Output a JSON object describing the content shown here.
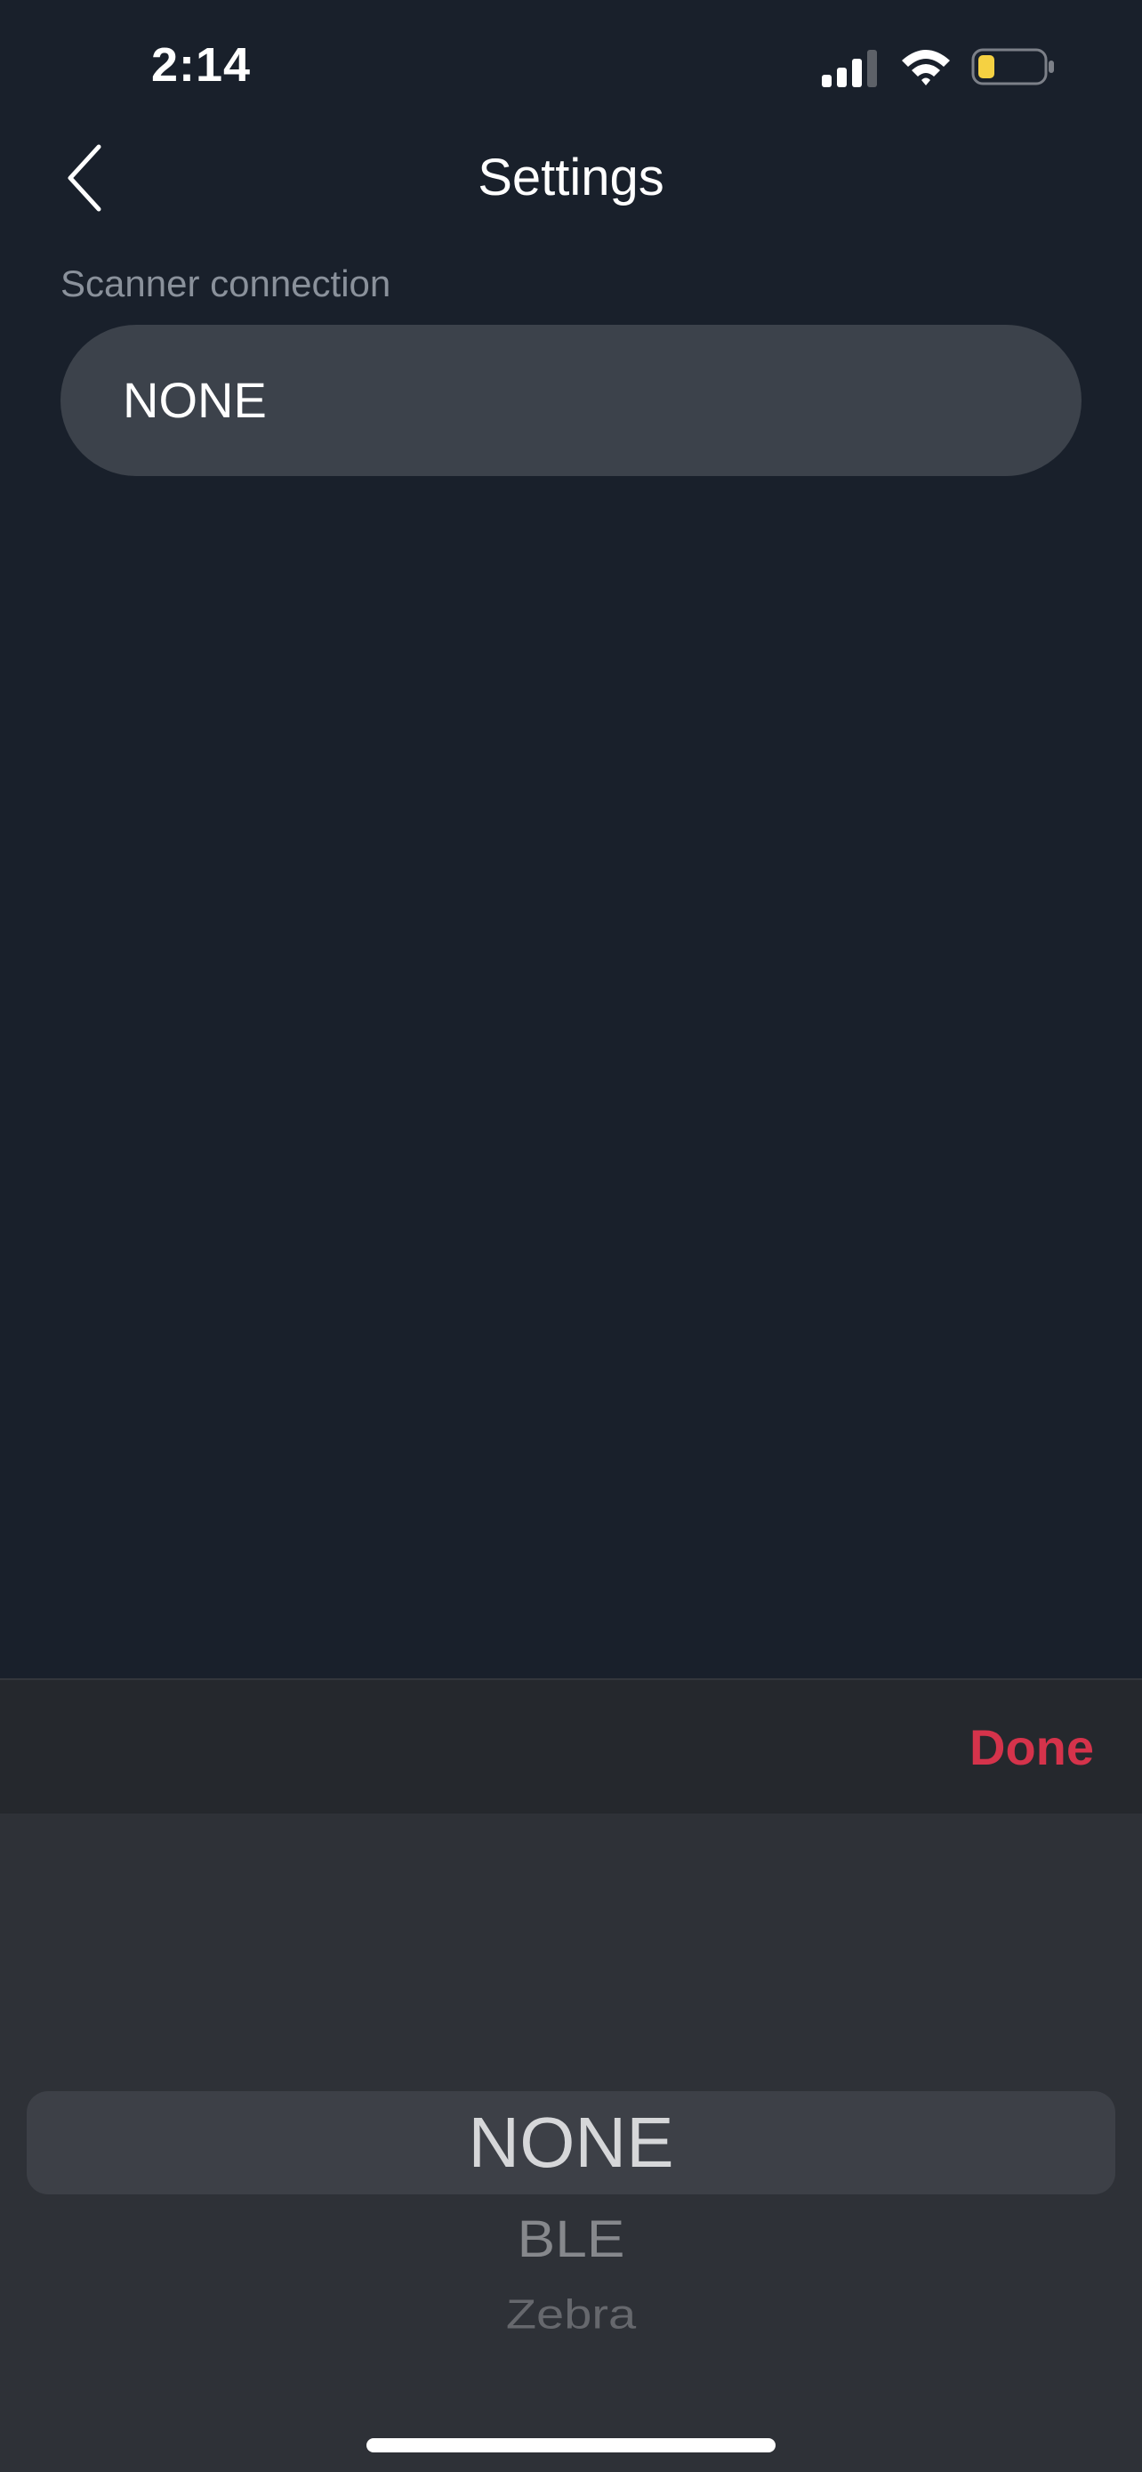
{
  "status_bar": {
    "time": "2:14",
    "icons": [
      "signal-icon",
      "wifi-icon",
      "battery-icon"
    ],
    "battery_color": "#f5d142"
  },
  "nav": {
    "title": "Settings",
    "back_icon": "chevron-left-icon"
  },
  "scanner": {
    "label": "Scanner connection",
    "value": "NONE"
  },
  "picker": {
    "done_label": "Done",
    "accent_color": "#d5334b",
    "options": [
      "NONE",
      "BLE",
      "Zebra"
    ],
    "selected": "NONE"
  }
}
